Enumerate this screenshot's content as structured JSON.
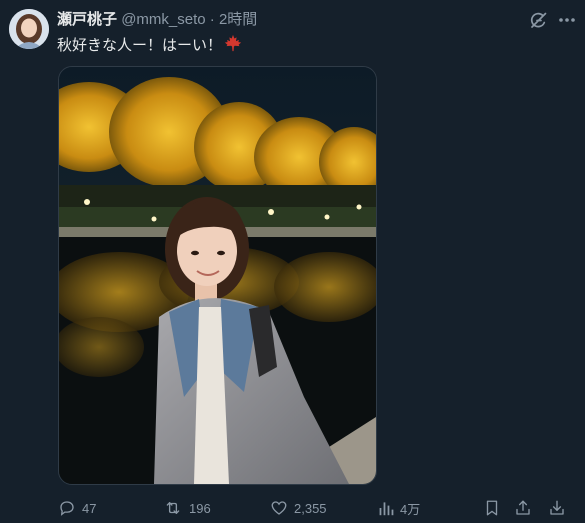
{
  "author": {
    "name": "瀬戸桃子",
    "handle": "@mmk_seto",
    "separator": "·",
    "time": "2時間"
  },
  "tweet": {
    "text": "秋好きな人ー！はーい！",
    "emoji_icon": "maple-leaf-icon"
  },
  "metrics": {
    "replies": "47",
    "reposts": "196",
    "likes": "2,355",
    "views": "4万"
  },
  "icons": {
    "grok": "grok-icon",
    "more": "more-icon",
    "reply": "reply-icon",
    "repost": "repost-icon",
    "like": "heart-icon",
    "views": "views-icon",
    "bookmark": "bookmark-icon",
    "share": "share-icon",
    "download": "download-icon"
  },
  "colors": {
    "background": "#15202b",
    "text": "#e7e9ea",
    "muted": "#8b98a5",
    "maple": "#d4382f"
  }
}
